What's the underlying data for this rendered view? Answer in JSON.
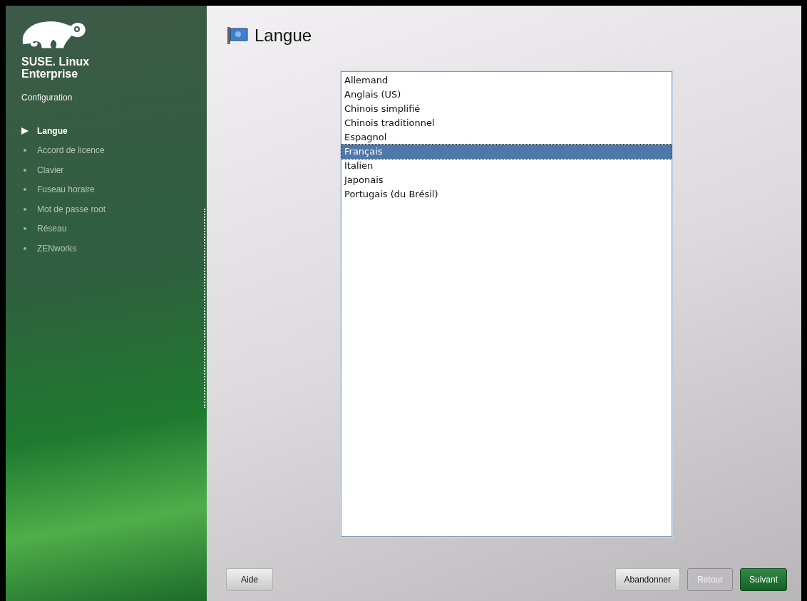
{
  "sidebar": {
    "brand": [
      "SUSE. Linux",
      "Enterprise"
    ],
    "section": "Configuration",
    "items": [
      {
        "label": "Langue",
        "selected": true
      },
      {
        "label": "Accord de licence",
        "selected": false
      },
      {
        "label": "Clavier",
        "selected": false
      },
      {
        "label": "Fuseau horaire",
        "selected": false
      },
      {
        "label": "Mot de passe root",
        "selected": false
      },
      {
        "label": "Réseau",
        "selected": false
      },
      {
        "label": "ZENworks",
        "selected": false
      }
    ]
  },
  "page": {
    "title": "Langue"
  },
  "languages": [
    {
      "label": "Allemand",
      "selected": false
    },
    {
      "label": "Anglais (US)",
      "selected": false
    },
    {
      "label": "Chinois simplifié",
      "selected": false
    },
    {
      "label": "Chinois traditionnel",
      "selected": false
    },
    {
      "label": "Espagnol",
      "selected": false
    },
    {
      "label": "Français",
      "selected": true
    },
    {
      "label": "Italien",
      "selected": false
    },
    {
      "label": "Japonais",
      "selected": false
    },
    {
      "label": "Portugais (du Brésil)",
      "selected": false
    }
  ],
  "buttons": {
    "help": {
      "label": "Aide",
      "disabled": false
    },
    "abort": {
      "label": "Abandonner",
      "disabled": false
    },
    "back": {
      "label": "Retour",
      "disabled": true
    },
    "next": {
      "label": "Suivant",
      "disabled": false
    }
  }
}
